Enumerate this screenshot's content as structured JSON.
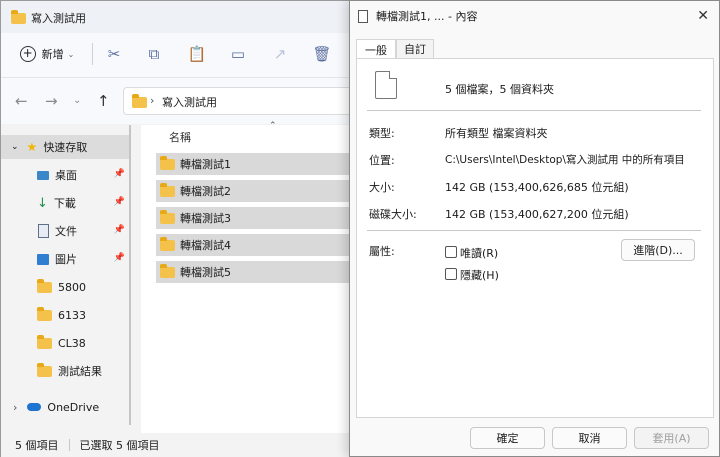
{
  "explorer": {
    "title": "寫入測試用",
    "toolbar": {
      "new_label": "新增"
    },
    "address": {
      "path": "寫入測試用"
    },
    "column_name": "名稱",
    "sidebar": {
      "quick_access": "快速存取",
      "items": [
        {
          "label": "桌面",
          "icon": "desktop-icon",
          "pinned": true
        },
        {
          "label": "下載",
          "icon": "download-icon",
          "pinned": true
        },
        {
          "label": "文件",
          "icon": "document-icon",
          "pinned": true
        },
        {
          "label": "圖片",
          "icon": "picture-icon",
          "pinned": true
        },
        {
          "label": "5800",
          "icon": "folder-icon",
          "pinned": false
        },
        {
          "label": "6133",
          "icon": "folder-icon",
          "pinned": false
        },
        {
          "label": "CL38",
          "icon": "folder-icon",
          "pinned": false
        },
        {
          "label": "測試結果",
          "icon": "folder-icon",
          "pinned": false
        }
      ],
      "onedrive": "OneDrive"
    },
    "files": [
      "轉檔測試1",
      "轉檔測試2",
      "轉檔測試3",
      "轉檔測試4",
      "轉檔測試5"
    ],
    "status": {
      "count": "5 個項目",
      "selected": "已選取 5 個項目"
    }
  },
  "dialog": {
    "title": "轉檔測試1, ... - 內容",
    "tabs": [
      "一般",
      "自訂"
    ],
    "summary": "5 個檔案，5 個資料夾",
    "rows": [
      {
        "label": "類型:",
        "value": "所有類型 檔案資料夾"
      },
      {
        "label": "位置:",
        "value": "C:\\Users\\Intel\\Desktop\\寫入測試用 中的所有項目"
      },
      {
        "label": "大小:",
        "value": "142 GB (153,400,626,685 位元組)"
      },
      {
        "label": "磁碟大小:",
        "value": "142 GB (153,400,627,200 位元組)"
      }
    ],
    "attributes_label": "屬性:",
    "readonly": "唯讀(R)",
    "hidden": "隱藏(H)",
    "advanced": "進階(D)...",
    "ok": "確定",
    "cancel": "取消",
    "apply": "套用(A)"
  }
}
